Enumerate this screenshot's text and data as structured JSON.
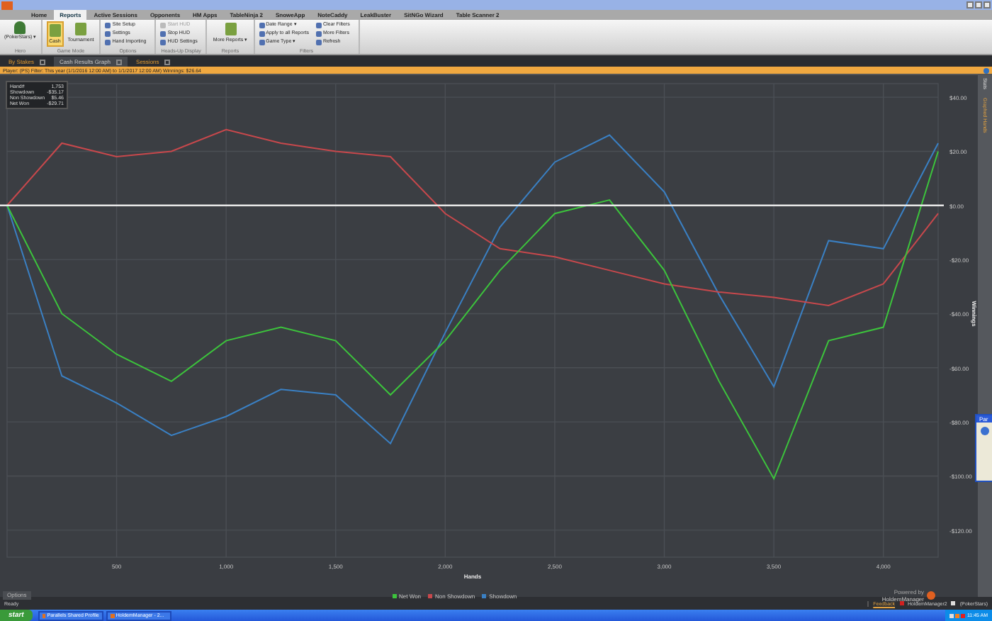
{
  "menu_tabs": [
    {
      "label": "Home",
      "selected": false
    },
    {
      "label": "Reports",
      "selected": true
    },
    {
      "label": "Active Sessions",
      "selected": false
    },
    {
      "label": "Opponents",
      "selected": false
    },
    {
      "label": "HM Apps",
      "selected": false
    },
    {
      "label": "TableNinja 2",
      "selected": false
    },
    {
      "label": "SnoweApp",
      "selected": false
    },
    {
      "label": "NoteCaddy",
      "selected": false
    },
    {
      "label": "LeakBuster",
      "selected": false
    },
    {
      "label": "SitNGo Wizard",
      "selected": false
    },
    {
      "label": "Table Scanner 2",
      "selected": false
    }
  ],
  "ribbon": {
    "groups": [
      {
        "title": "Hero",
        "items": [
          {
            "kind": "avatar",
            "label": "(PokerStars) ▾"
          }
        ]
      },
      {
        "title": "Game Mode",
        "items": [
          {
            "kind": "big",
            "label": "Cash",
            "selected": true
          },
          {
            "kind": "big",
            "label": "Tournament",
            "selected": false
          }
        ]
      },
      {
        "title": "Options",
        "items": [
          {
            "kind": "small",
            "label": "Site Setup",
            "disabled": false
          },
          {
            "kind": "small",
            "label": "Settings",
            "disabled": false
          },
          {
            "kind": "small",
            "label": "Hand Importing",
            "disabled": false
          }
        ]
      },
      {
        "title": "Heads-Up Display",
        "items": [
          {
            "kind": "small",
            "label": "Start HUD",
            "disabled": true
          },
          {
            "kind": "small",
            "label": "Stop HUD",
            "disabled": false
          },
          {
            "kind": "small",
            "label": "HUD Settings",
            "disabled": false
          }
        ]
      },
      {
        "title": "Reports",
        "items": [
          {
            "kind": "big",
            "label": "More Reports ▾",
            "selected": false
          }
        ]
      },
      {
        "title": "Filters",
        "items": [
          {
            "kind": "small",
            "label": "Date Range ▾",
            "disabled": false
          },
          {
            "kind": "small",
            "label": "Apply to all Reports",
            "disabled": false
          },
          {
            "kind": "small",
            "label": "Game Type ▾",
            "disabled": false
          },
          {
            "kind": "small",
            "label": "Clear Filters",
            "disabled": false
          },
          {
            "kind": "small",
            "label": "More Filters",
            "disabled": false
          },
          {
            "kind": "small",
            "label": "Refresh",
            "disabled": false
          }
        ]
      }
    ]
  },
  "doc_tabs": [
    {
      "label": "By Stakes",
      "selected": false
    },
    {
      "label": "Cash Results Graph",
      "selected": true
    },
    {
      "label": "Sessions",
      "selected": false
    }
  ],
  "filter_bar": {
    "text": "Player: (PS) Filter: This year (1/1/2016 12:00 AM) to 1/1/2017 12:00 AM) Winnings: $26.64"
  },
  "side_strip": [
    "Stats",
    "Graphed Hands"
  ],
  "legend_box": [
    {
      "label": "Hand#",
      "value": "1,753"
    },
    {
      "label": "Showdown",
      "value": "-$35.17"
    },
    {
      "label": "Non Showdown",
      "value": "$5.46"
    },
    {
      "label": "Net Won",
      "value": "-$29.71"
    }
  ],
  "chart_data": {
    "type": "line",
    "xlabel": "Hands",
    "ylabel": "Winnings",
    "x": [
      0,
      250,
      500,
      750,
      1000,
      1250,
      1500,
      1750,
      2000,
      2250,
      2500,
      2750,
      3000,
      3250,
      3500,
      3750,
      4000,
      4250
    ],
    "series": [
      {
        "name": "Net Won",
        "color": "#3cc43c",
        "values": [
          0,
          -40,
          -55,
          -65,
          -50,
          -45,
          -50,
          -70,
          -50,
          -24,
          -3,
          2,
          -24,
          -65,
          -101,
          -50,
          -45,
          20
        ]
      },
      {
        "name": "Non Showdown",
        "color": "#c8484c",
        "values": [
          0,
          23,
          18,
          20,
          28,
          23,
          20,
          18,
          -3,
          -16,
          -19,
          -24,
          -29,
          -32,
          -34,
          -37,
          -29,
          -3
        ]
      },
      {
        "name": "Showdown",
        "color": "#3a80c4",
        "values": [
          0,
          -63,
          -73,
          -85,
          -78,
          -68,
          -70,
          -88,
          -47,
          -8,
          16,
          26,
          5,
          -33,
          -67,
          -13,
          -16,
          23
        ]
      }
    ],
    "xlim": [
      0,
      4250
    ],
    "ylim": [
      -130,
      45
    ],
    "grid": true,
    "xticks": [
      {
        "value": 500,
        "label": "500"
      },
      {
        "value": 1000,
        "label": "1,000"
      },
      {
        "value": 1500,
        "label": "1,500"
      },
      {
        "value": 2000,
        "label": "2,000"
      },
      {
        "value": 2500,
        "label": "2,500"
      },
      {
        "value": 3000,
        "label": "3,000"
      },
      {
        "value": 3500,
        "label": "3,500"
      },
      {
        "value": 4000,
        "label": "4,000"
      }
    ],
    "yticks": [
      {
        "value": 40,
        "label": "$40.00"
      },
      {
        "value": 20,
        "label": "$20.00"
      },
      {
        "value": 0,
        "label": "$0.00"
      },
      {
        "value": -20,
        "label": "-$20.00"
      },
      {
        "value": -40,
        "label": "-$40.00"
      },
      {
        "value": -60,
        "label": "-$60.00"
      },
      {
        "value": -80,
        "label": "-$80.00"
      },
      {
        "value": -100,
        "label": "-$100.00"
      },
      {
        "value": -120,
        "label": "-$120.00"
      }
    ]
  },
  "powered_by": {
    "caption": "Powered by",
    "brand": "HoldemManager"
  },
  "options_button": "Options",
  "popup": {
    "title": "Par"
  },
  "status_bar": {
    "left": "Ready",
    "items": [
      "Feedback",
      "HoldemManager2",
      "(PokerStars)"
    ]
  },
  "taskbar": {
    "start": "start",
    "items": [
      "Parallels Shared Profile",
      "HoldemManager - 2..."
    ],
    "time": "11:45 AM"
  }
}
